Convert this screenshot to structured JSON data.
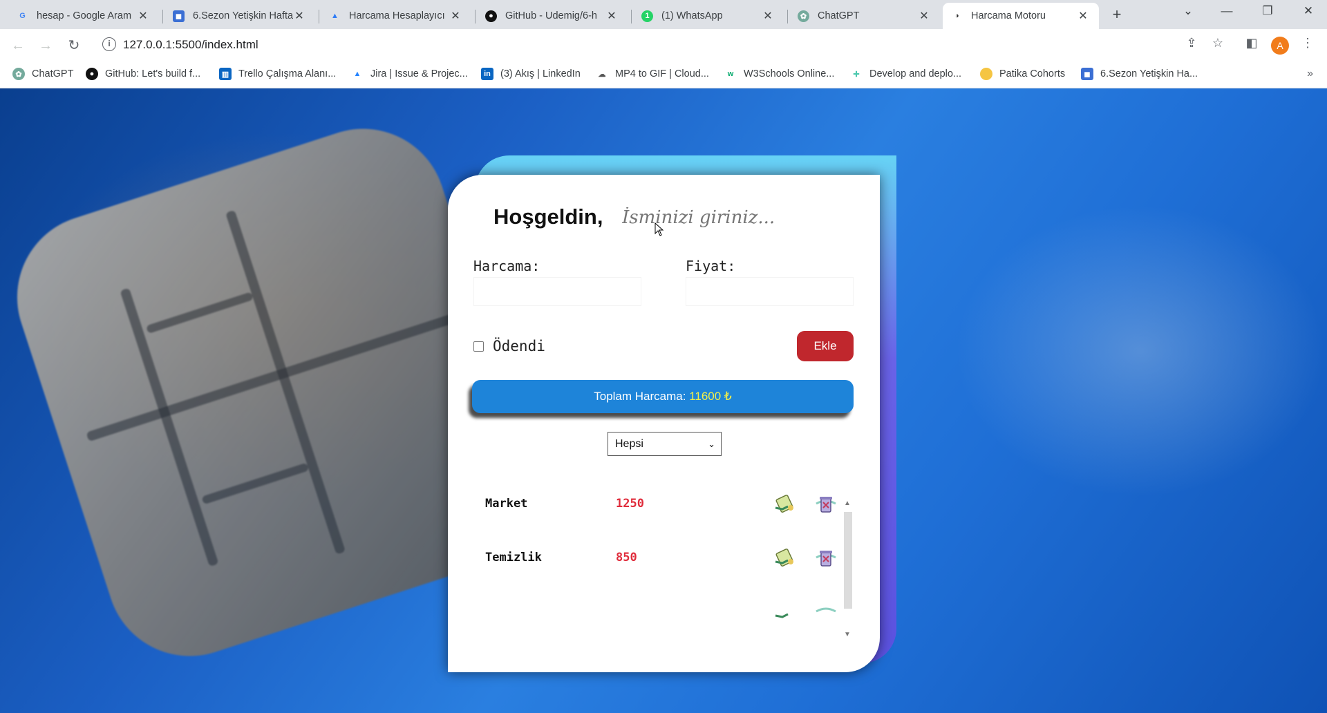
{
  "browser": {
    "tabs": [
      {
        "title": "hesap - Google Aram",
        "icon": "google-icon",
        "color": "#4285f4"
      },
      {
        "title": "6.Sezon Yetişkin Hafta",
        "icon": "classroom-icon",
        "color": "#3b6fd4"
      },
      {
        "title": "Harcama Hesaplayıcı",
        "icon": "bitbucket-icon",
        "color": "#2f7cf6"
      },
      {
        "title": "GitHub - Udemig/6-h",
        "icon": "github-icon",
        "color": "#111111"
      },
      {
        "title": "(1) WhatsApp",
        "icon": "whatsapp-icon",
        "color": "#25d366"
      },
      {
        "title": "ChatGPT",
        "icon": "chatgpt-icon",
        "color": "#74aa9c"
      },
      {
        "title": "Harcama Motoru",
        "icon": "page-icon",
        "color": "#333333"
      }
    ],
    "url": "127.0.0.1:5500/index.html",
    "profile_initial": "A",
    "bookmarks": [
      {
        "label": "ChatGPT",
        "icon": "chatgpt-icon",
        "color": "#74aa9c"
      },
      {
        "label": "GitHub: Let's build f...",
        "icon": "github-icon",
        "color": "#111111"
      },
      {
        "label": "Trello Çalışma Alanı...",
        "icon": "trello-icon",
        "color": "#0b66c2"
      },
      {
        "label": "Jira | Issue & Projec...",
        "icon": "jira-icon",
        "color": "#2684ff"
      },
      {
        "label": "(3) Akış | LinkedIn",
        "icon": "linkedin-icon",
        "color": "#0a66c2"
      },
      {
        "label": "MP4 to GIF | Cloud...",
        "icon": "cloudconvert-icon",
        "color": "#555555"
      },
      {
        "label": "W3Schools Online...",
        "icon": "w3schools-icon",
        "color": "#04aa6d"
      },
      {
        "label": "Develop and deplo...",
        "icon": "deploy-icon",
        "color": "#2cbfa0"
      },
      {
        "label": "Patika Cohorts",
        "icon": "patika-icon",
        "color": "#f5c542"
      },
      {
        "label": "6.Sezon Yetişkin Ha...",
        "icon": "classroom-icon",
        "color": "#3b6fd4"
      }
    ]
  },
  "app": {
    "greeting": "Hoşgeldin,",
    "name_placeholder": "İsminizi giriniz...",
    "expense_label": "Harcama:",
    "price_label": "Fiyat:",
    "paid_label": "Ödendi",
    "add_button": "Ekle",
    "total_label": "Toplam Harcama:",
    "total_amount": "11600 ₺",
    "filter_selected": "Hepsi",
    "items": [
      {
        "name": "Market",
        "price": "1250"
      },
      {
        "name": "Temizlik",
        "price": "850"
      }
    ]
  },
  "colors": {
    "add_button": "#c0272d",
    "total_bar": "#1e84d9",
    "total_amount": "#f4f04a",
    "price_text": "#e02d3c"
  }
}
